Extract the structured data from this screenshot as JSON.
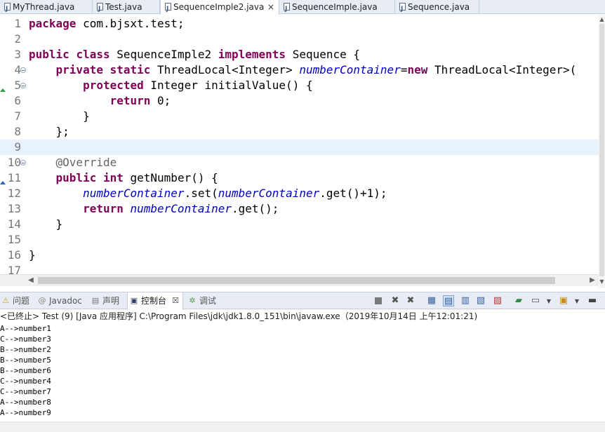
{
  "editor_tabs": [
    {
      "label": "MyThread.java",
      "active": false
    },
    {
      "label": "Test.java",
      "active": false
    },
    {
      "label": "SequenceImple2.java",
      "active": true,
      "close": "×"
    },
    {
      "label": "SequenceImple.java",
      "active": false
    },
    {
      "label": "Sequence.java",
      "active": false
    }
  ],
  "code": {
    "line_numbers": [
      "1",
      "2",
      "3",
      "4",
      "5",
      "6",
      "7",
      "8",
      "9",
      "10",
      "11",
      "12",
      "13",
      "14",
      "15",
      "16",
      "17"
    ],
    "package_kw": "package",
    "package_name": " com.bjsxt.test;",
    "public_kw": "public",
    "class_kw": "class",
    "class_name": " SequenceImple2 ",
    "implements_kw": "implements",
    "iface": " Sequence {",
    "private_kw": "private",
    "static_kw": "static",
    "tl_type": " ThreadLocal<Integer> ",
    "field": "numberContainer",
    "eq": "=",
    "new_kw": "new",
    "tl_new": " ThreadLocal<Integer>(",
    "protected_kw": "protected",
    "init_sig": " Integer initialValue() {",
    "return_kw": "return",
    "ret_zero": " 0;",
    "close_brace": "}",
    "close_anon": "};",
    "override": "@Override",
    "int_kw": "int",
    "getnum_sig": " getNumber() {",
    "set_call": ".set(",
    "get_plus": ".get()+1);",
    "get_end": ".get();"
  },
  "views": {
    "tabs": [
      {
        "icon": "⚠",
        "label": "问题",
        "active": false
      },
      {
        "icon": "@",
        "label": "Javadoc",
        "active": false
      },
      {
        "icon": "▤",
        "label": "声明",
        "active": false
      },
      {
        "icon": "▣",
        "label": "控制台",
        "active": true,
        "close": "☒"
      },
      {
        "icon": "✲",
        "label": "调试",
        "active": false
      }
    ]
  },
  "console": {
    "header": "<已终止> Test (9) [Java 应用程序] C:\\Program Files\\jdk\\jdk1.8.0_151\\bin\\javaw.exe（2019年10月14日 上午12:01:21)",
    "lines": [
      "A-->number1",
      "C-->number3",
      "B-->number2",
      "B-->number5",
      "B-->number6",
      "C-->number4",
      "C-->number7",
      "A-->number8",
      "A-->number9"
    ]
  },
  "colors": {
    "keyword": "#7f0055",
    "field": "#0000c0",
    "annotation": "#646464",
    "current_line": "#e8f2fe",
    "tab_bar": "#e8edf5"
  }
}
